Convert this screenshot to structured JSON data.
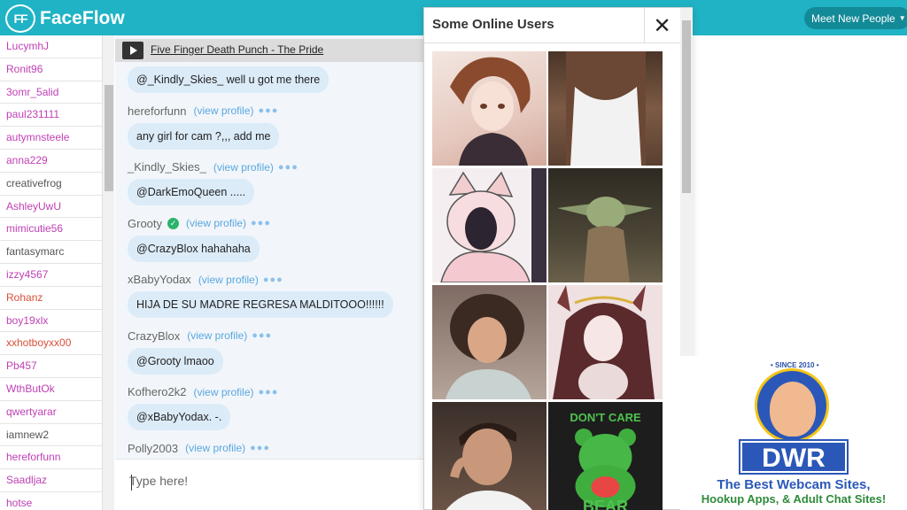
{
  "header": {
    "logo_mark": "FF",
    "logo_text": "FaceFlow",
    "meet_button": "Meet New People",
    "accent": "#1fb3c5"
  },
  "userlist": [
    {
      "name": "LucymhJ",
      "color": "#c03fb5"
    },
    {
      "name": "Ronit96",
      "color": "#c03fb5"
    },
    {
      "name": "3omr_5alid",
      "color": "#c03fb5"
    },
    {
      "name": "paul231111",
      "color": "#c03fb5"
    },
    {
      "name": "autymnsteele",
      "color": "#c03fb5"
    },
    {
      "name": "anna229",
      "color": "#c03fb5"
    },
    {
      "name": "creativefrog",
      "color": "#555555"
    },
    {
      "name": "AshleyUwU",
      "color": "#c03fb5"
    },
    {
      "name": "mimicutie56",
      "color": "#c03fb5"
    },
    {
      "name": "fantasymarc",
      "color": "#555555"
    },
    {
      "name": "izzy4567",
      "color": "#c03fb5"
    },
    {
      "name": "Rohanz",
      "color": "#d9503a"
    },
    {
      "name": "boy19xlx",
      "color": "#c03fb5"
    },
    {
      "name": "xxhotboyxx00",
      "color": "#d9503a"
    },
    {
      "name": "Pb457",
      "color": "#c03fb5"
    },
    {
      "name": "WthButOk",
      "color": "#c03fb5"
    },
    {
      "name": "qwertyarar",
      "color": "#c03fb5"
    },
    {
      "name": "iamnew2",
      "color": "#555555"
    },
    {
      "name": "hereforfunn",
      "color": "#c03fb5"
    },
    {
      "name": "Saadljaz",
      "color": "#c03fb5"
    },
    {
      "name": "hotse",
      "color": "#c03fb5"
    }
  ],
  "now_playing": {
    "song": "Five Finger Death Punch - The Pride"
  },
  "messages": [
    {
      "user": "",
      "text": "@_Kindly_Skies_ well u got me there",
      "verified": false
    },
    {
      "user": "hereforfunn",
      "text": "any girl for cam ?,,, add me",
      "verified": false
    },
    {
      "user": "_Kindly_Skies_",
      "text": "@DarkEmoQueen .....",
      "verified": false
    },
    {
      "user": "Grooty",
      "text": "@CrazyBlox hahahaha",
      "verified": true
    },
    {
      "user": "xBabyYodax",
      "text": "HIJA DE SU MADRE REGRESA MALDITOOO!!!!!!",
      "verified": false
    },
    {
      "user": "CrazyBlox",
      "text": "@Grooty lmaoo",
      "verified": false
    },
    {
      "user": "Kofhero2k2",
      "text": "@xBabyYodax. -.",
      "verified": false
    },
    {
      "user": "Polly2003",
      "text": "",
      "verified": false
    }
  ],
  "view_profile_label": "(view profile)",
  "dots_label": "●●●",
  "check_glyph": "✓",
  "input": {
    "placeholder": "Type here!"
  },
  "online_panel": {
    "title": "Some Online Users",
    "close_glyph": "✕",
    "tiles": [
      "anime-boy",
      "man-tank-top",
      "anime-cat-girl",
      "baby-yoda",
      "curly-hair-person",
      "anime-horned-girl",
      "young-man",
      "dont-care-bear"
    ],
    "bear_text_top": "DON'T CARE",
    "bear_text_bottom": "BEAR"
  },
  "ad": {
    "since": "• SINCE 2010 •",
    "brand": "DWR",
    "line1": "The Best Webcam Sites,",
    "line2": "Hookup Apps, & Adult Chat Sites!"
  }
}
